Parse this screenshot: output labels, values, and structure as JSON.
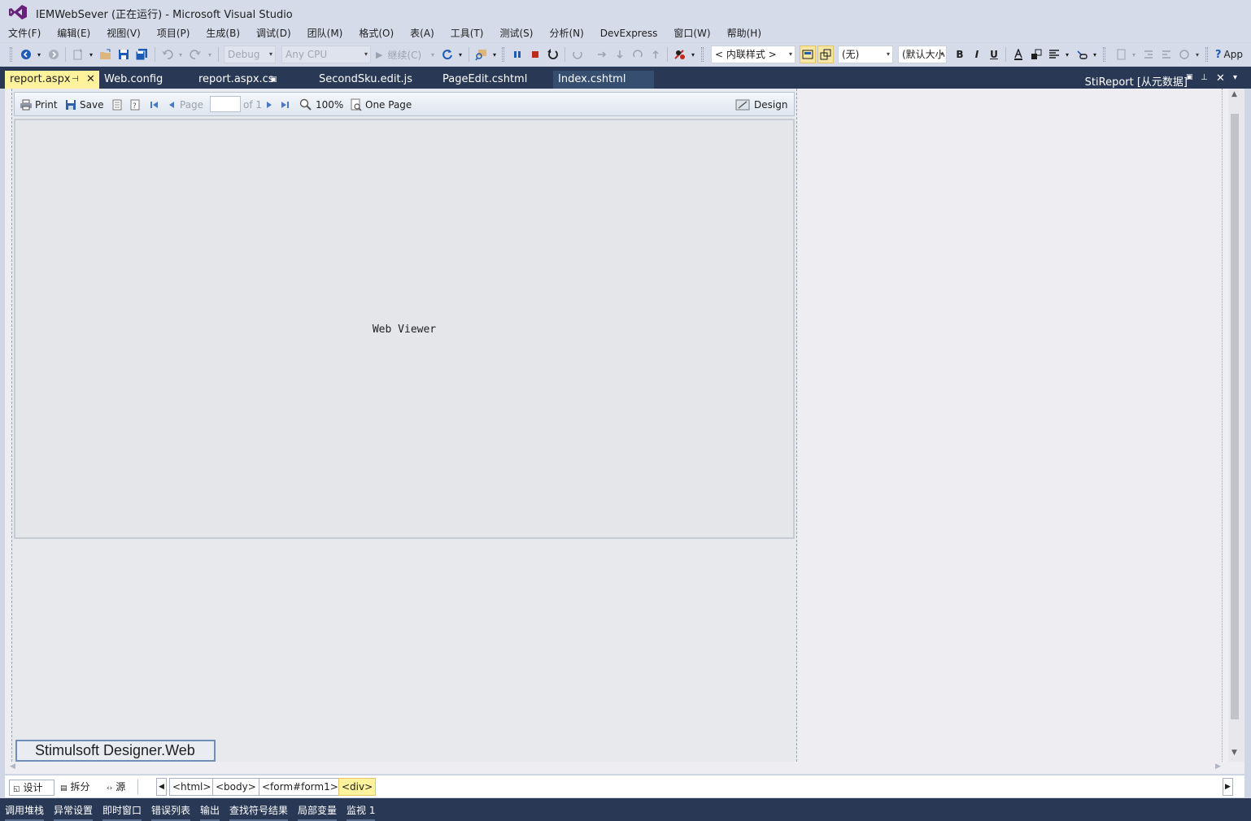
{
  "window": {
    "title": "IEMWebSever (正在运行) - Microsoft Visual Studio"
  },
  "menu": [
    "文件(F)",
    "编辑(E)",
    "视图(V)",
    "项目(P)",
    "生成(B)",
    "调试(D)",
    "团队(M)",
    "格式(O)",
    "表(A)",
    "工具(T)",
    "测试(S)",
    "分析(N)",
    "DevExpress",
    "窗口(W)",
    "帮助(H)"
  ],
  "toolbar": {
    "config": "Debug",
    "platform": "Any CPU",
    "continue_label": "继续(C)",
    "style_target": "< 内联样式 >",
    "block_format": "(无)",
    "font_name": "(默认大小)",
    "bold": "B",
    "italic": "I",
    "underline": "U",
    "app_label": "App"
  },
  "doc_tabs": [
    {
      "label": "report.aspx",
      "active": true
    },
    {
      "label": "Web.config",
      "active": false
    },
    {
      "label": "report.aspx.cs",
      "active": false
    },
    {
      "label": "SecondSku.edit.js",
      "active": false
    },
    {
      "label": "PageEdit.cshtml",
      "active": false
    },
    {
      "label": "Index.cshtml",
      "active": false
    }
  ],
  "right_panel_title": "StiReport [从元数据]",
  "viewer_toolbar": {
    "print": "Print",
    "save": "Save",
    "page": "Page",
    "of": "of 1",
    "zoom": "100%",
    "one_page": "One Page",
    "design": "Design"
  },
  "viewer_label": "Web Viewer",
  "designer_label": "Stimulsoft Designer.Web",
  "view_modes": [
    "设计",
    "拆分",
    "源"
  ],
  "breadcrumb_tags": [
    "<html>",
    "<body>",
    "<form#form1>",
    "<div>"
  ],
  "bottom_tabs": [
    "调用堆栈",
    "异常设置",
    "即时窗口",
    "错误列表",
    "输出",
    "查找符号结果",
    "局部变量",
    "监视 1"
  ],
  "colors": {
    "chrome": "#d6dbe9",
    "tab_bar": "#293955",
    "active_tab": "#fff29d",
    "accent_purple": "#68217a"
  }
}
